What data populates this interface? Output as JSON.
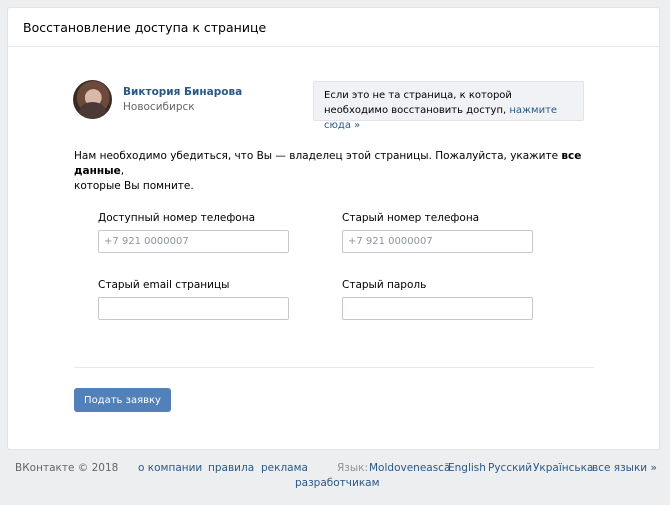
{
  "header": {
    "title": "Восстановление доступа к странице"
  },
  "profile": {
    "name": "Виктория Бинарова",
    "city": "Новосибирск"
  },
  "notice": {
    "text": "Если это не та страница, к которой необходимо восстановить доступ,",
    "link": "нажмите сюда »"
  },
  "intro": {
    "text": "Нам необходимо убедиться, что Вы — владелец этой страницы. Пожалуйста, укажите",
    "bold": "все данные",
    "tail": ",",
    "line2": "которые Вы помните."
  },
  "fields": {
    "phone": {
      "label": "Доступный номер телефона",
      "placeholder": "+7 921 0000007"
    },
    "old_phone": {
      "label": "Старый номер телефона",
      "placeholder": "+7 921 0000007"
    },
    "email": {
      "label": "Старый email страницы",
      "placeholder": ""
    },
    "password": {
      "label": "Старый пароль",
      "placeholder": ""
    }
  },
  "submit": {
    "label": "Подать заявку"
  },
  "footer": {
    "copyright": "ВКонтакте © 2018",
    "links": [
      "о компании",
      "правила",
      "реклама",
      "разработчикам"
    ],
    "language_label": "Язык:",
    "languages": [
      "Moldovenească",
      "English",
      "Русский",
      "Українська",
      "все языки »"
    ]
  }
}
